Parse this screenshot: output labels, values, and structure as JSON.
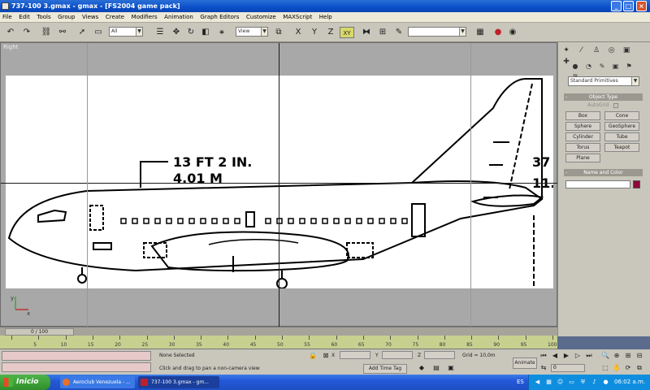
{
  "window": {
    "title": "737-100 3.gmax - gmax - [FS2004 game pack]",
    "controls": {
      "minimize": "_",
      "maximize": "□",
      "close": "×"
    }
  },
  "menubar": {
    "items": [
      "File",
      "Edit",
      "Tools",
      "Group",
      "Views",
      "Create",
      "Modifiers",
      "Animation",
      "Graph Editors",
      "Customize",
      "MAXScript",
      "Help"
    ]
  },
  "toolbar": {
    "selection_filter": "All",
    "reference_coord": "View",
    "named_selection": "",
    "axis_x": "X",
    "axis_y": "Y",
    "axis_z": "Z",
    "axis_xy": "XY"
  },
  "viewport": {
    "label": "Right",
    "drawing_text": {
      "dimension_ft": "13 FT 2 IN.",
      "dimension_m": "4.01 M",
      "tail_top": "37",
      "tail_bottom": "11."
    },
    "gizmo_labels": {
      "y": "y",
      "x": "x"
    }
  },
  "command_panel": {
    "category_dropdown": "Standard Primitives",
    "object_type_rollout": "Object Type",
    "autogrid_label": "AutoGrid",
    "primitives": [
      "Box",
      "Cone",
      "Sphere",
      "GeoSphere",
      "Cylinder",
      "Tube",
      "Torus",
      "Teapot",
      "Plane"
    ],
    "name_color_rollout": "Name and Color",
    "name_value": "",
    "object_color": "#8b0a3a"
  },
  "timeline": {
    "frame_counter": "0 / 100",
    "ticks": [
      "5",
      "10",
      "15",
      "20",
      "25",
      "30",
      "35",
      "40",
      "45",
      "50",
      "55",
      "60",
      "65",
      "70",
      "75",
      "80",
      "85",
      "90",
      "95",
      "100"
    ]
  },
  "status": {
    "selection": "None Selected",
    "prompt": "Click and drag to pan a non-camera view",
    "x_label": "X",
    "y_label": "Y",
    "z_label": "Z",
    "grid": "Grid = 10,0m",
    "add_time_tag": "Add Time Tag",
    "animate": "Animate",
    "frame_field": "0"
  },
  "taskbar": {
    "start": "Inicio",
    "tasks": [
      "Aeroclub Venezuela - ...",
      "737-100 3.gmax - gm..."
    ],
    "language": "ES",
    "clock": "06:02 a.m."
  }
}
